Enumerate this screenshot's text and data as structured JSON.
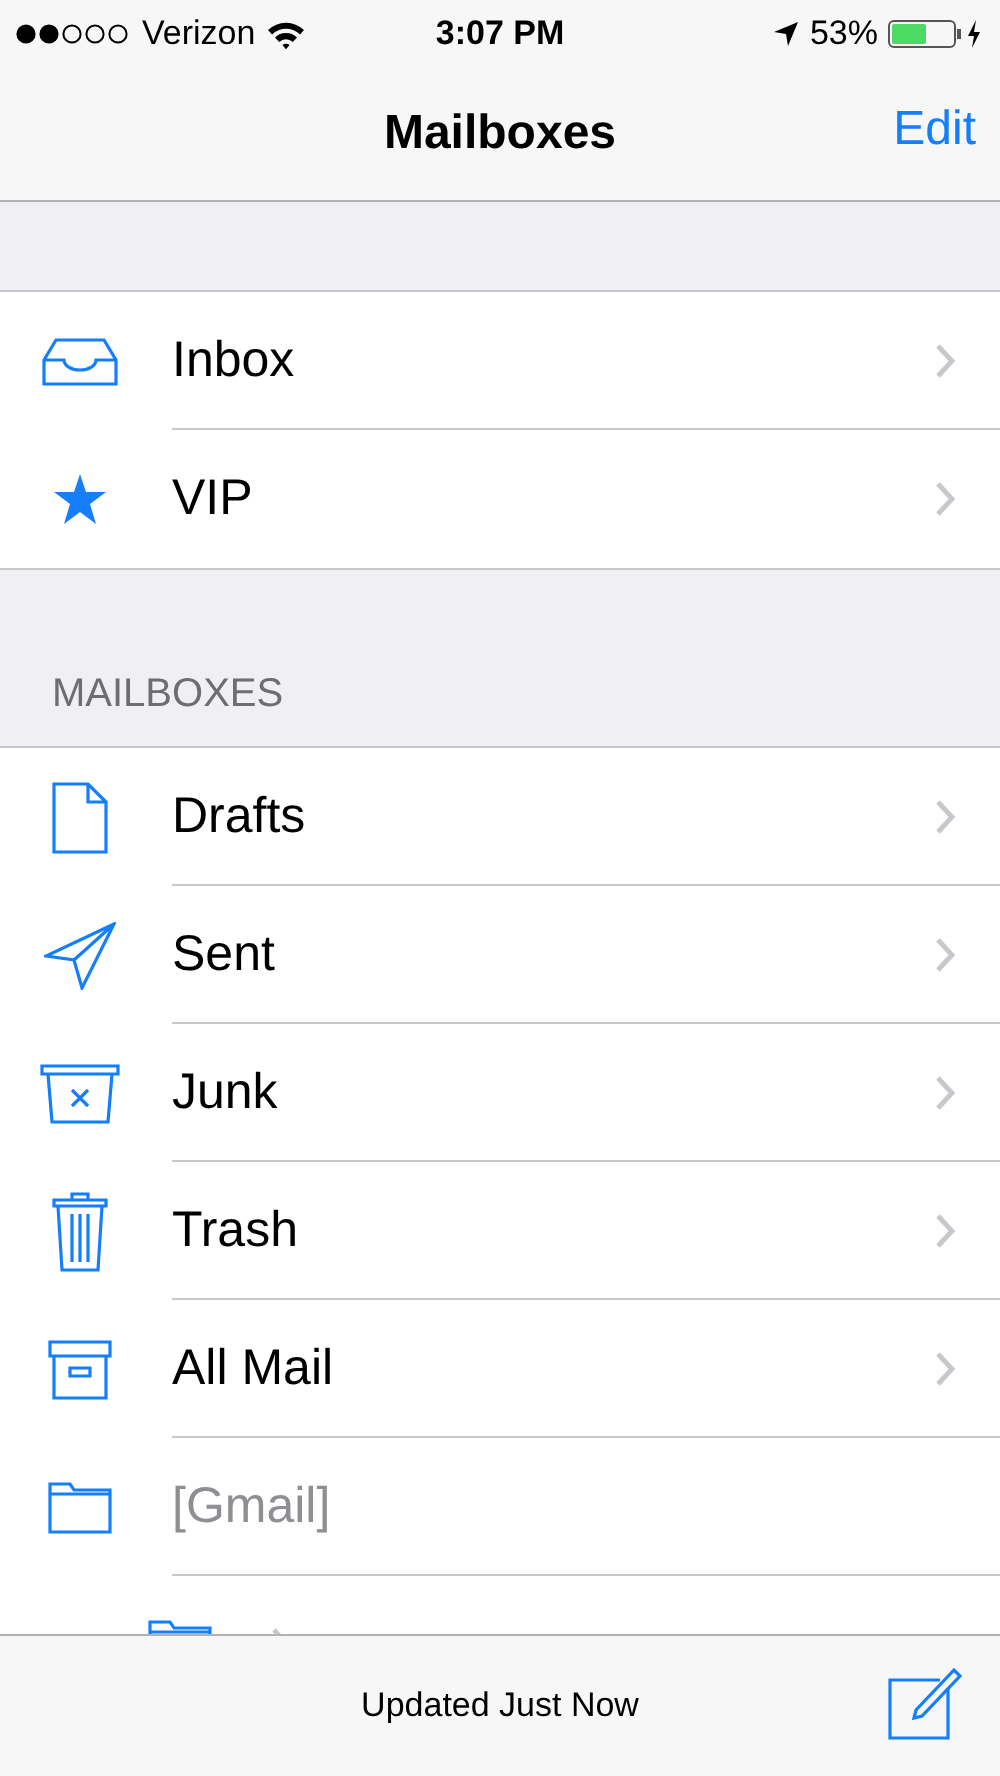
{
  "status_bar": {
    "carrier": "Verizon",
    "time": "3:07 PM",
    "battery": "53%"
  },
  "nav": {
    "title": "Mailboxes",
    "edit": "Edit"
  },
  "groups": [
    {
      "items": [
        {
          "kind": "inbox",
          "label": "Inbox",
          "disabled": false
        },
        {
          "kind": "star",
          "label": "VIP",
          "disabled": false
        }
      ]
    },
    {
      "header": "MAILBOXES",
      "items": [
        {
          "kind": "draft",
          "label": "Drafts",
          "disabled": false
        },
        {
          "kind": "sent",
          "label": "Sent",
          "disabled": false
        },
        {
          "kind": "junk",
          "label": "Junk",
          "disabled": false
        },
        {
          "kind": "trash",
          "label": "Trash",
          "disabled": false
        },
        {
          "kind": "archive",
          "label": "All Mail",
          "disabled": false
        },
        {
          "kind": "folder",
          "label": "[Gmail]",
          "disabled": true,
          "children": [
            {
              "kind": "folder",
              "disabled": false
            }
          ]
        }
      ]
    }
  ],
  "toolbar": {
    "status": "Updated Just Now"
  }
}
